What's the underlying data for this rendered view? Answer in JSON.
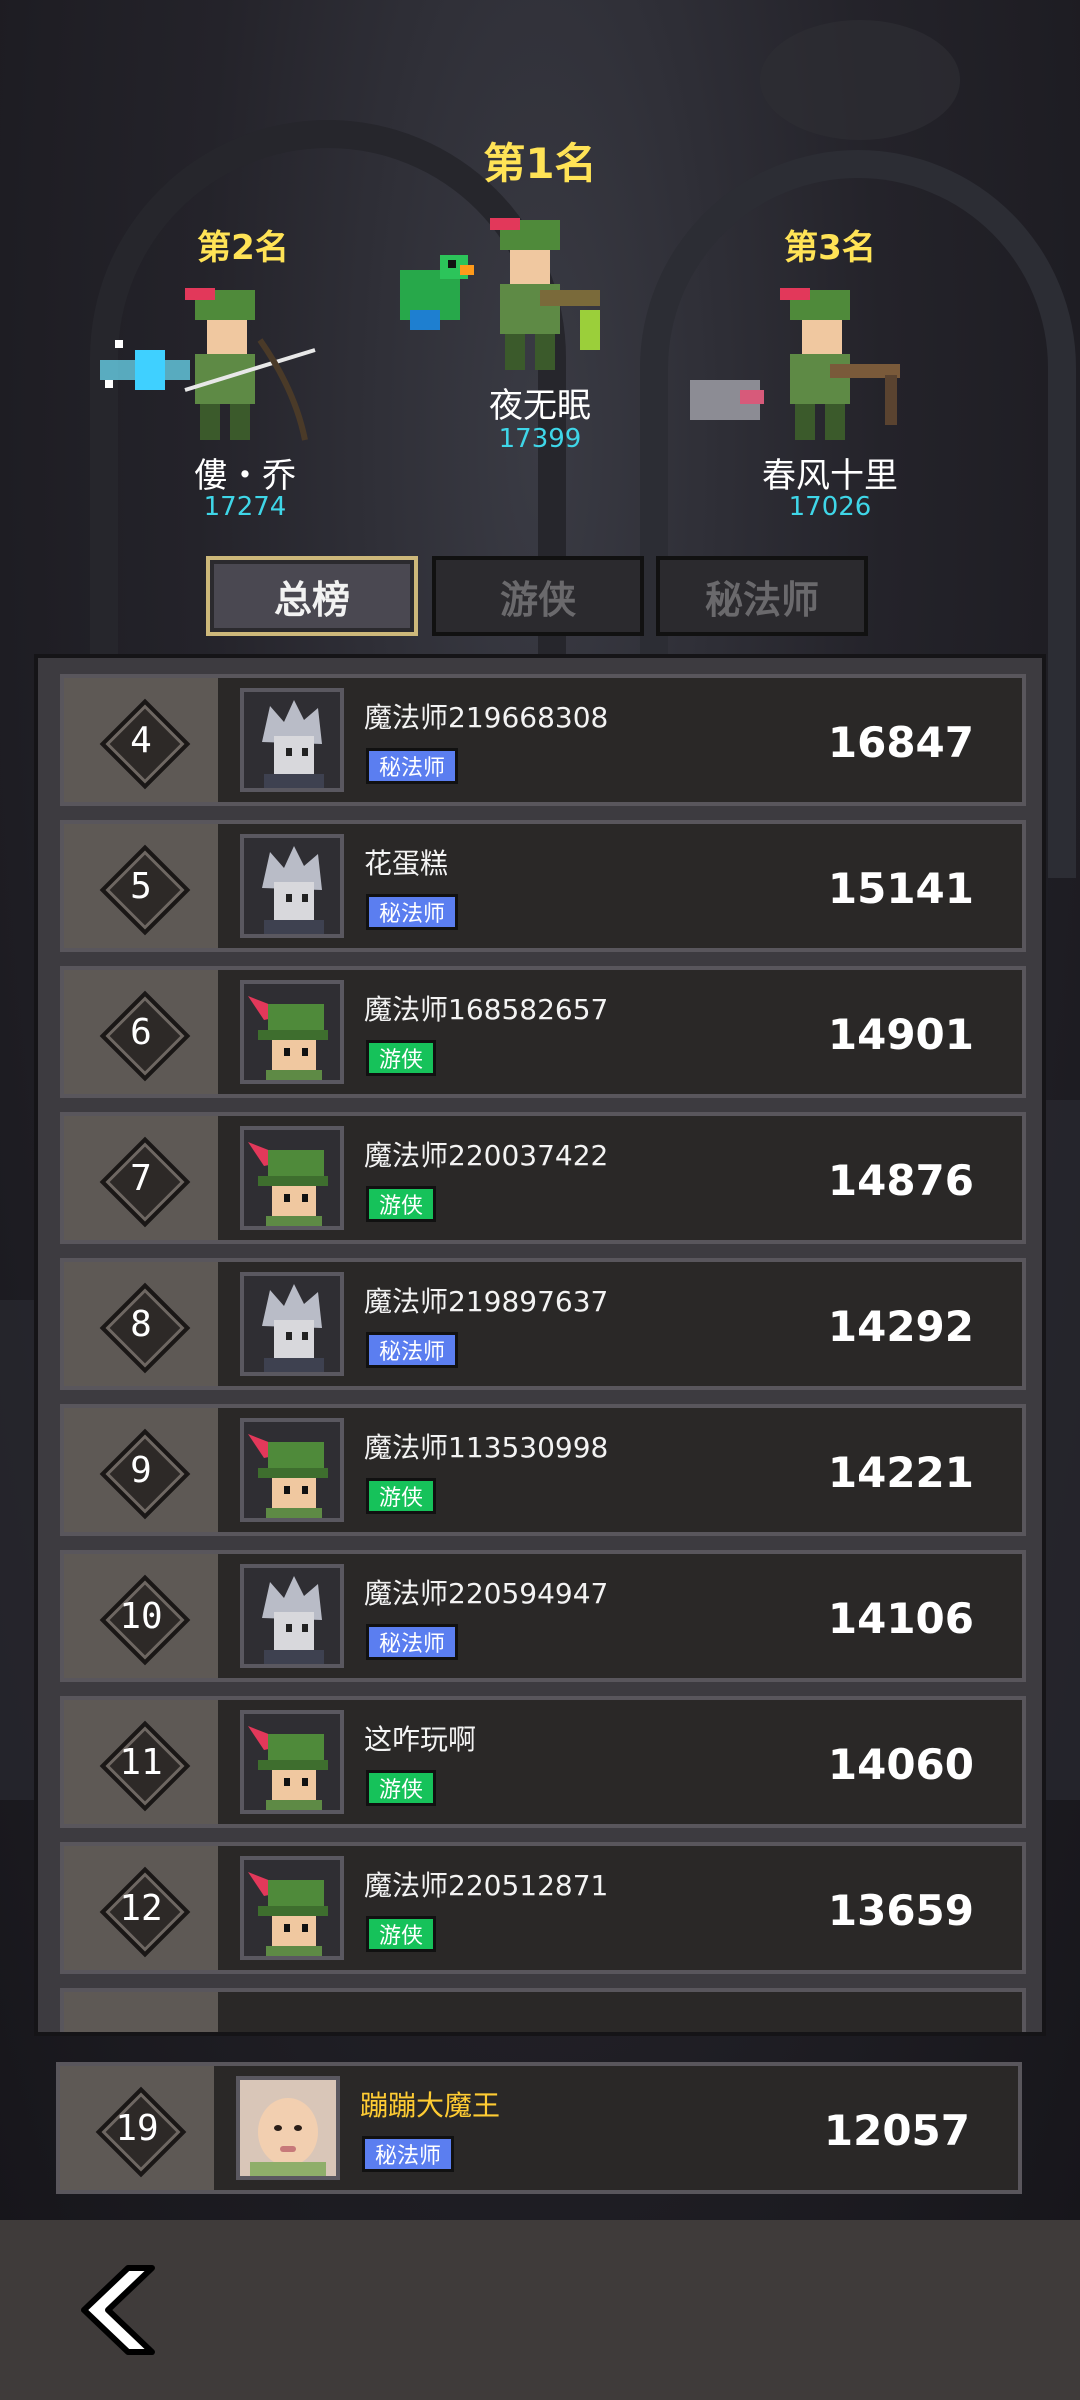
{
  "podium": [
    {
      "rank_label": "第1名",
      "name": "夜无眠",
      "score": "17399"
    },
    {
      "rank_label": "第2名",
      "name": "僂・乔",
      "score": "17274"
    },
    {
      "rank_label": "第3名",
      "name": "春风十里",
      "score": "17026"
    }
  ],
  "tabs": [
    {
      "label": "总榜",
      "active": true
    },
    {
      "label": "游侠",
      "active": false
    },
    {
      "label": "秘法师",
      "active": false
    }
  ],
  "rows": [
    {
      "rank": "4",
      "name": "魔法师219668308",
      "class": "秘法师",
      "class_type": "mage",
      "score": "16847"
    },
    {
      "rank": "5",
      "name": "花蛋糕",
      "class": "秘法师",
      "class_type": "mage",
      "score": "15141"
    },
    {
      "rank": "6",
      "name": "魔法师168582657",
      "class": "游侠",
      "class_type": "ranger",
      "score": "14901"
    },
    {
      "rank": "7",
      "name": "魔法师220037422",
      "class": "游侠",
      "class_type": "ranger",
      "score": "14876"
    },
    {
      "rank": "8",
      "name": "魔法师219897637",
      "class": "秘法师",
      "class_type": "mage",
      "score": "14292"
    },
    {
      "rank": "9",
      "name": "魔法师113530998",
      "class": "游侠",
      "class_type": "ranger",
      "score": "14221"
    },
    {
      "rank": "10",
      "name": "魔法师220594947",
      "class": "秘法师",
      "class_type": "mage",
      "score": "14106"
    },
    {
      "rank": "11",
      "name": "这咋玩啊",
      "class": "游侠",
      "class_type": "ranger",
      "score": "14060"
    },
    {
      "rank": "12",
      "name": "魔法师220512871",
      "class": "游侠",
      "class_type": "ranger",
      "score": "13659"
    }
  ],
  "my_row": {
    "rank": "19",
    "name": "蹦蹦大魔王",
    "class": "秘法师",
    "class_type": "mage",
    "score": "12057"
  },
  "colors": {
    "rank_title": "#ffe356",
    "podium_score": "#3fd6e8",
    "mage_badge": "#5b7ef0",
    "ranger_badge": "#16c25a",
    "my_name": "#ffcc33"
  },
  "icons": {
    "back": "chevron-left-icon"
  }
}
